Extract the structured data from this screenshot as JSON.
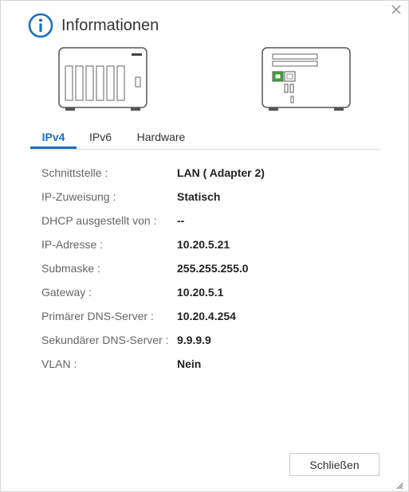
{
  "dialog": {
    "title": "Informationen",
    "icons": {
      "title": "info-icon",
      "close": "close-icon",
      "resize": "resize-grip-icon"
    },
    "accent": "#1a6fc3"
  },
  "tabs": [
    {
      "label": "IPv4",
      "active": true
    },
    {
      "label": "IPv6",
      "active": false
    },
    {
      "label": "Hardware",
      "active": false
    }
  ],
  "details": [
    {
      "label": "Schnittstelle :",
      "value": "LAN ( Adapter 2)"
    },
    {
      "label": "IP-Zuweisung :",
      "value": "Statisch"
    },
    {
      "label": "DHCP ausgestellt von :",
      "value": "--"
    },
    {
      "label": "IP-Adresse :",
      "value": "10.20.5.21"
    },
    {
      "label": "Submaske :",
      "value": "255.255.255.0"
    },
    {
      "label": "Gateway :",
      "value": "10.20.5.1"
    },
    {
      "label": "Primärer DNS-Server :",
      "value": "10.20.4.254"
    },
    {
      "label": "Sekundärer DNS-Server :",
      "value": "9.9.9.9"
    },
    {
      "label": "VLAN :",
      "value": "Nein"
    }
  ],
  "footer": {
    "close_label": "Schließen"
  }
}
